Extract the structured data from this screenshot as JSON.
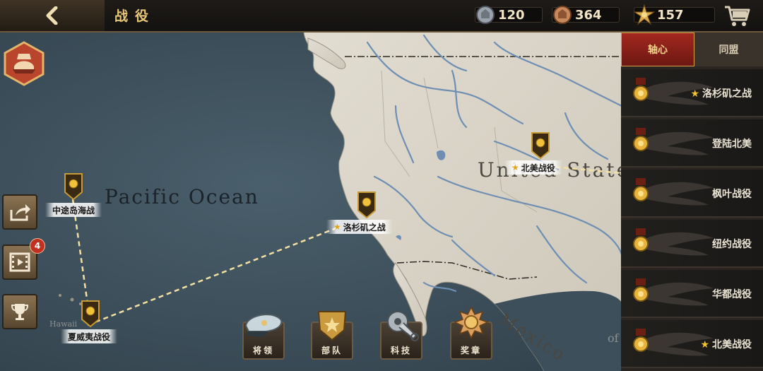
{
  "header": {
    "title": "战役",
    "resources": [
      {
        "name": "silver-medal",
        "value": "120"
      },
      {
        "name": "bronze-medal",
        "value": "364"
      },
      {
        "name": "honor-star",
        "value": "157"
      }
    ]
  },
  "map": {
    "ocean_label": "Pacific Ocean",
    "land_label_us": "United States",
    "land_label_mexico": "Mexico",
    "island_label": "Hawaii",
    "edge_label": "of",
    "markers": [
      {
        "id": "midway",
        "label": "中途岛海战",
        "starred": false
      },
      {
        "id": "hawaii",
        "label": "夏威夷战役",
        "starred": false
      },
      {
        "id": "la",
        "label": "洛杉矶之战",
        "starred": true
      },
      {
        "id": "na",
        "label": "北美战役",
        "starred": true
      }
    ]
  },
  "left_column": {
    "notification_count": "4"
  },
  "bottom_nav": [
    {
      "label": "将领",
      "icon": "general-cap-icon"
    },
    {
      "label": "部队",
      "icon": "troops-shield-icon"
    },
    {
      "label": "科技",
      "icon": "tech-gear-icon"
    },
    {
      "label": "奖章",
      "icon": "medal-icon"
    }
  ],
  "side_panel": {
    "tabs": [
      {
        "label": "轴心",
        "active": true
      },
      {
        "label": "同盟",
        "active": false
      }
    ],
    "campaigns": [
      {
        "label": "洛杉矶之战",
        "starred": true
      },
      {
        "label": "登陆北美",
        "starred": false
      },
      {
        "label": "枫叶战役",
        "starred": false
      },
      {
        "label": "纽约战役",
        "starred": false
      },
      {
        "label": "华都战役",
        "starred": false
      },
      {
        "label": "北美战役",
        "starred": true
      }
    ]
  },
  "colors": {
    "ocean": "#3c4f5b",
    "land": "#d8d3c7",
    "river": "#6e8fb3",
    "gold": "#e8c776",
    "axis_red": "#a3281f"
  }
}
